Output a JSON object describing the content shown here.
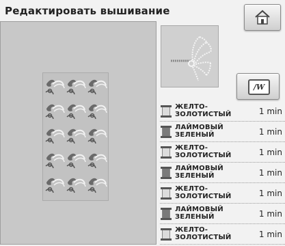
{
  "header": {
    "title": "Редактировать вышивание"
  },
  "colors": {
    "accent_dark": "#7a7a7a",
    "accent_light": "#dcdcdc"
  },
  "threads": [
    {
      "name": "ЖЕЛТО-\nЗОЛОТИСТЫЙ",
      "time": "1 min",
      "shade": "light"
    },
    {
      "name": "ЛАЙМОВЫЙ\nЗЕЛЕНЫЙ",
      "time": "1 min",
      "shade": "dark"
    },
    {
      "name": "ЖЕЛТО-\nЗОЛОТИСТЫЙ",
      "time": "1 min",
      "shade": "light"
    },
    {
      "name": "ЛАЙМОВЫЙ\nЗЕЛЕНЫЙ",
      "time": "1 min",
      "shade": "dark"
    },
    {
      "name": "ЖЕЛТО-\nЗОЛОТИСТЫЙ",
      "time": "1 min",
      "shade": "light"
    },
    {
      "name": "ЛАЙМОВЫЙ\nЗЕЛЕНЫЙ",
      "time": "1 min",
      "shade": "dark"
    },
    {
      "name": "ЖЕЛТО-\nЗОЛОТИСТЫЙ",
      "time": "1 min",
      "shade": "light"
    }
  ],
  "icons": {
    "home": "home-icon",
    "stitch": "stitch-view-icon"
  }
}
